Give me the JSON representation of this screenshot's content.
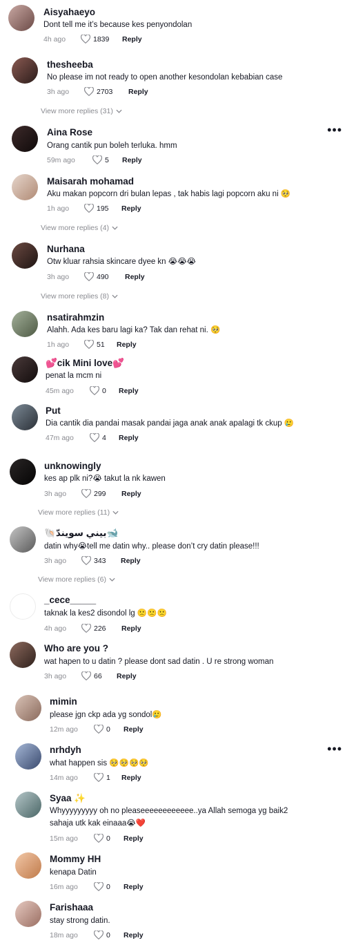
{
  "comments": [
    {
      "username": "Aisyahaeyo",
      "text": "Dont tell me it’s because kes penyondolan",
      "time": "4h ago",
      "likes": "1839",
      "reply": "Reply"
    },
    {
      "username": "thesheeba",
      "text": "No please im not ready to open another kesondolan kebabian case",
      "time": "3h ago",
      "likes": "2703",
      "reply": "Reply",
      "more": "View more replies (31)"
    },
    {
      "username": "Aina Rose",
      "text": "Orang cantik pun boleh terluka. hmm",
      "time": "59m ago",
      "likes": "5",
      "reply": "Reply"
    },
    {
      "username": "Maisarah mohamad",
      "text": "Aku makan popcorn dri bulan lepas , tak habis lagi popcorn aku ni 🥺",
      "time": "1h ago",
      "likes": "195",
      "reply": "Reply",
      "more": "View more replies (4)"
    },
    {
      "username": "Nurhana",
      "text": "Otw kluar rahsia skincare dyee kn 😭😭😭",
      "time": "3h ago",
      "likes": "490",
      "reply": "Reply",
      "more": "View more replies (8)"
    },
    {
      "username": "nsatirahmzin",
      "text": "Alahh. Ada kes baru lagi ka? Tak dan rehat ni. 🥺",
      "time": "1h ago",
      "likes": "51",
      "reply": "Reply"
    },
    {
      "username": "💕cik Mini love💕",
      "text": "penat la mcm ni",
      "time": "45m ago",
      "likes": "0",
      "reply": "Reply"
    },
    {
      "username": "Put",
      "text": "Dia cantik dia pandai masak pandai jaga anak anak apalagi tk ckup 🥲",
      "time": "47m ago",
      "likes": "4",
      "reply": "Reply"
    },
    {
      "username": "unknowingly",
      "text": "kes ap plk ni?😭 takut la nk kawen",
      "time": "3h ago",
      "likes": "299",
      "reply": "Reply",
      "more": "View more replies (11)"
    },
    {
      "username": "🐚بيني سويندّ🐋",
      "text": "datin why😭tell me datin why.. please don’t cry datin please!!!",
      "time": "3h ago",
      "likes": "343",
      "reply": "Reply",
      "more": "View more replies (6)"
    },
    {
      "username": "_cece_____",
      "text": "taknak la kes2 disondol lg 🙁🙁🙁",
      "time": "4h ago",
      "likes": "226",
      "reply": "Reply"
    },
    {
      "username": "Who are you ?",
      "text": "wat hapen to u datin ? please dont sad datin . U re strong woman",
      "time": "3h ago",
      "likes": "66",
      "reply": "Reply"
    },
    {
      "username": "mimin",
      "text": "please jgn ckp ada yg sondol🥲",
      "time": "12m ago",
      "likes": "0",
      "reply": "Reply"
    },
    {
      "username": "nrhdyh",
      "text": "what happen sis 🥺🥺🥺🥺",
      "time": "14m ago",
      "likes": "1",
      "reply": "Reply"
    },
    {
      "username": "Syaa ✨",
      "text": "Whyyyyyyyyy oh no pleaseeeeeeeeeeee..ya Allah semoga yg baik2",
      "text2": "sahaja utk kak einaaa😭❤️",
      "time": "15m ago",
      "likes": "0",
      "reply": "Reply"
    },
    {
      "username": "Mommy HH",
      "text": "kenapa Datin",
      "time": "16m ago",
      "likes": "0",
      "reply": "Reply"
    },
    {
      "username": "Farishaaa",
      "text": "stay strong datin.",
      "time": "18m ago",
      "likes": "0",
      "reply": "Reply"
    }
  ],
  "icons": {
    "like": "heart-outline-icon",
    "more": "chevron-down-icon",
    "options": "ellipsis-icon"
  },
  "colors": {
    "text": "#161823",
    "muted": "#8a8b91",
    "background": "#ffffff"
  }
}
